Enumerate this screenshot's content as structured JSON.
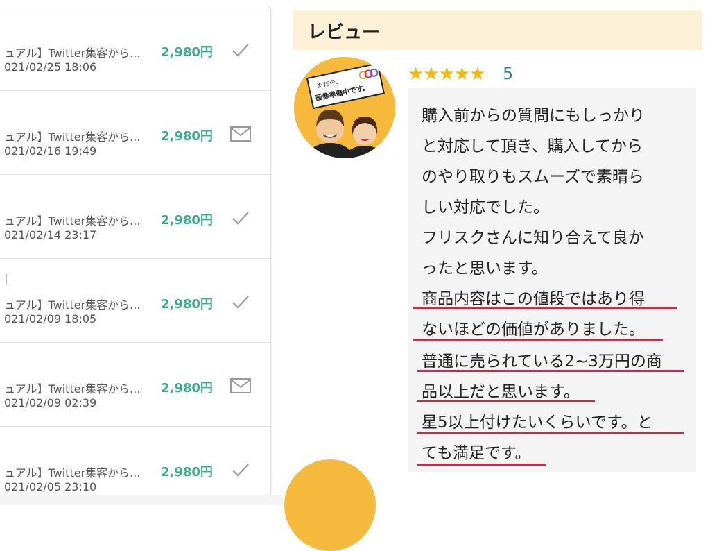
{
  "sales": [
    {
      "title": "ュアル】Twitter集客から...",
      "date": "021/02/25 18:06",
      "price": "2,980円",
      "status_icon": "check-icon",
      "extra": ""
    },
    {
      "title": "ュアル】Twitter集客から...",
      "date": "021/02/16 19:49",
      "price": "2,980円",
      "status_icon": "mail-icon",
      "extra": ""
    },
    {
      "title": "ュアル】Twitter集客から...",
      "date": "021/02/14 23:17",
      "price": "2,980円",
      "status_icon": "check-icon",
      "extra": ""
    },
    {
      "title": "ュアル】Twitter集客から...",
      "date": "021/02/09 18:05",
      "price": "2,980円",
      "status_icon": "check-icon",
      "extra": "|"
    },
    {
      "title": "ュアル】Twitter集客から...",
      "date": "021/02/09 02:39",
      "price": "2,980円",
      "status_icon": "mail-icon",
      "extra": ""
    },
    {
      "title": "ュアル】Twitter集客から...",
      "date": "021/02/05 23:10",
      "price": "2,980円",
      "status_icon": "check-icon",
      "extra": ""
    }
  ],
  "review": {
    "header": "レビュー",
    "avatar_text_1": "ただ今、",
    "avatar_text_2": "画像準備中です。",
    "stars": "★★★★★",
    "rating": "5",
    "lines": [
      "購入前からの質問にもしっかり",
      "と対応して頂き、購入してから",
      "のやり取りもスムーズで素晴ら",
      "しい対応でした。",
      "フリスクさんに知り合えて良か",
      "ったと思います。",
      "商品内容はこの値段ではあり得",
      "ないほどの価値がありました。",
      "普通に売られている2~3万円の商",
      "品以上だと思います。",
      "星5以上付けたいくらいです。と",
      "ても満足です。"
    ]
  },
  "colors": {
    "price_green": "#3aaa8c",
    "star_gold": "#f5b90a",
    "rating_blue": "#2f7fb8",
    "header_cream": "#fcf1d7",
    "underline_red": "#d9243f"
  }
}
